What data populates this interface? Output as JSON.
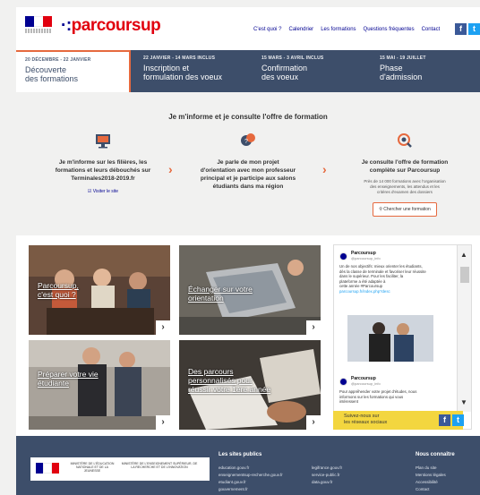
{
  "header": {
    "brand": "parcoursup",
    "nav": [
      "C'est quoi ?",
      "Calendrier",
      "Les formations",
      "Questions fréquentes",
      "Contact"
    ],
    "social": [
      "facebook-icon",
      "twitter-icon"
    ]
  },
  "timeline": [
    {
      "dates": "20 DÉCEMBRE - 22 JANVIER",
      "title1": "Découverte",
      "title2": "des formations"
    },
    {
      "dates": "22 JANVIER - 14 MARS INCLUS",
      "title1": "Inscription et",
      "title2": "formulation des voeux"
    },
    {
      "dates": "15 MARS - 3 AVRIL INCLUS",
      "title1": "Confirmation",
      "title2": "des voeux"
    },
    {
      "dates": "15 MAI - 19 JUILLET",
      "title1": "Phase",
      "title2": "d'admission"
    }
  ],
  "inform": {
    "title": "Je m'informe et je consulte l'offre de formation",
    "col1": {
      "text1": "Je m'informe sur les filières, les",
      "text2": "formations et leurs débouchés sur",
      "text3": "Terminales2018-2019.fr",
      "link": "Visiter le site"
    },
    "col2": {
      "text1": "Je parle de mon projet",
      "text2": "d'orientation avec mon professeur",
      "text3": "principal et je participe aux salons",
      "text4": "étudiants dans ma région"
    },
    "col3": {
      "text1": "Je consulte l'offre de formation",
      "text2": "complète sur Parcoursup",
      "small1": "Près de 14 000 formations avec l'organisation",
      "small2": "des enseignements, les attendus et les",
      "small3": "critères d'examen des dossiers",
      "button": "Chercher une formation"
    }
  },
  "cards": [
    {
      "line1": "Parcoursup,",
      "line2": "c'est quoi ?"
    },
    {
      "line1": "Échanger sur votre",
      "line2": "orientation"
    },
    {
      "line1": "Préparer votre vie",
      "line2": "étudiante"
    },
    {
      "line1": "Des parcours",
      "line2": "personnalisés pour",
      "line3": "réussir votre 1ère année"
    }
  ],
  "twitter": {
    "tweet1": {
      "name": "Parcoursup",
      "handle": "@parcoursup_info",
      "l1": "Un de nos objectifs: mieux orienter les étudiants,",
      "l2": "dès la classe de terminale et favoriser leur réussite",
      "l3": "dans le supérieur. Pour les faciliter, la",
      "l4": "plateforme a été adaptée à",
      "l5": "cette année #Parcoursup",
      "link": "parcoursup.fr/index.php?desc"
    },
    "tweet2": {
      "name": "Parcoursup",
      "handle": "@parcoursup_info",
      "l1": "Pour appréhender votre projet d'études, nous",
      "l2": "informons sur les formations qui vous",
      "l3": "intéressent"
    }
  },
  "follow": {
    "line1": "Suivez-nous sur",
    "line2": "les réseaux sociaux"
  },
  "footer": {
    "logo_text1": "MINISTÈRE DE L'ÉDUCATION NATIONALE ET DE LA JEUNESSE",
    "logo_text2": "MINISTÈRE DE L'ENSEIGNEMENT SUPÉRIEUR, DE LA RECHERCHE ET DE L'INNOVATION",
    "public_title": "Les sites publics",
    "public_col1": [
      "education.gouv.fr",
      "enseignementsup-recherche.gouv.fr",
      "etudiant.gouv.fr",
      "gouvernement.fr"
    ],
    "public_col2": [
      "legifrance.gouv.fr",
      "service-public.fr",
      "data.gouv.fr"
    ],
    "know_title": "Nous connaître",
    "know_list": [
      "Plan du site",
      "Mentions légales",
      "Accessibilité",
      "Contact"
    ]
  },
  "colors": {
    "navy": "#3d4e6a",
    "accent": "#e6693e",
    "brand_red": "#e1000f",
    "brand_blue": "#000091",
    "yellow": "#f3d63f"
  }
}
